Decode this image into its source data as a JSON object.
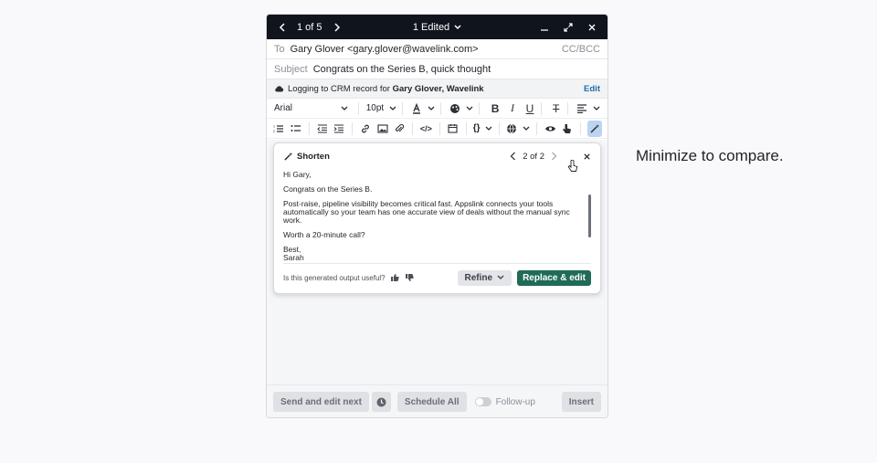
{
  "header": {
    "pager": "1 of 5",
    "edited": "1 Edited"
  },
  "to": {
    "label": "To",
    "value": "Gary Glover <gary.glover@wavelink.com>",
    "ccbcc": "CC/BCC"
  },
  "subject": {
    "label": "Subject",
    "value": "Congrats on the Series B, quick thought"
  },
  "crm": {
    "prefix": "Logging to CRM record for",
    "record": "Gary Glover, Wavelink",
    "edit": "Edit"
  },
  "toolbar": {
    "font": "Arial",
    "size": "10pt"
  },
  "popup": {
    "title": "Shorten",
    "pager": "2 of 2",
    "body": [
      "Hi Gary,",
      "Congrats on the Series B.",
      "Post-raise, pipeline visibility becomes critical fast. Appslink connects your tools automatically so your team has one accurate view of deals without the manual sync work.",
      "Worth a 20-minute call?",
      "Best,",
      "Sarah"
    ],
    "feedback_question": "Is this generated output useful?",
    "refine_label": "Refine",
    "replace_label": "Replace & edit"
  },
  "footer": {
    "send_edit_next": "Send and edit next",
    "schedule_all": "Schedule All",
    "follow_up": "Follow-up",
    "insert": "Insert"
  },
  "side_note": "Minimize to compare.",
  "colors": {
    "titlebar": "#10141c",
    "primary_button": "#1f6b57",
    "link": "#1d6fa8"
  }
}
